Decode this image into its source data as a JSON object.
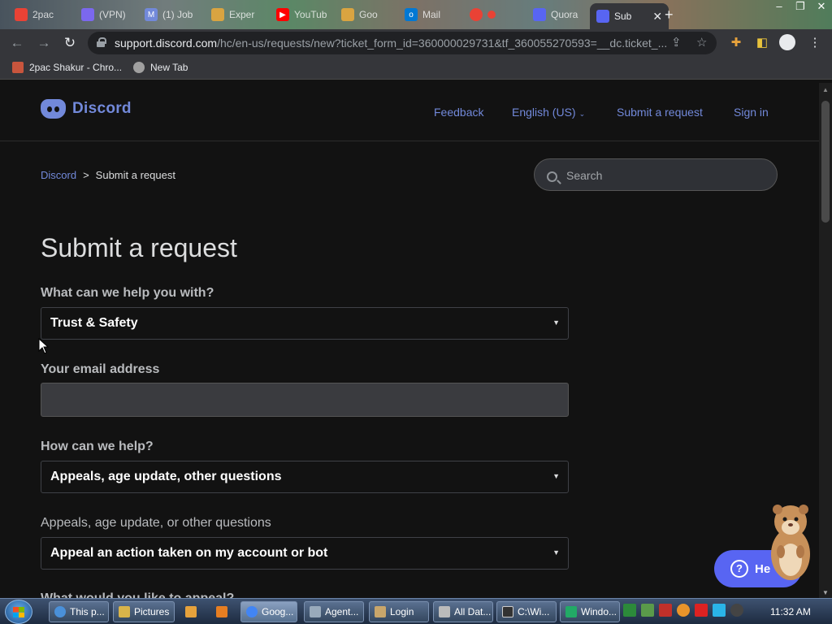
{
  "browser": {
    "tabs": [
      {
        "label": "2pac",
        "color": "#e94235"
      },
      {
        "label": "(VPN)",
        "color": "#7b68ee"
      },
      {
        "label": "(1) Job",
        "color": "#7289da"
      },
      {
        "label": "Exper",
        "color": "#d9a441"
      },
      {
        "label": "YouTub",
        "color": "#ff0000"
      },
      {
        "label": "Goo",
        "color": "#d9a441"
      },
      {
        "label": "Mail",
        "color": "#0078d4"
      },
      {
        "label": "",
        "color": "#e94235"
      },
      {
        "label": "Quora",
        "color": "#5865f2"
      },
      {
        "label": "Sub",
        "color": "#5865f2"
      }
    ],
    "url_host": "support.discord.com",
    "url_path": "/hc/en-us/requests/new?ticket_form_id=360000029731&tf_360055270593=__dc.ticket_...",
    "bookmarks": [
      {
        "label": "2pac Shakur - Chro...",
        "color": "#c8553d"
      },
      {
        "label": "New Tab",
        "color": "#a0a0a0"
      }
    ]
  },
  "site": {
    "brand": "Discord",
    "brand_color": "#7289da",
    "nav": {
      "feedback": "Feedback",
      "language": "English (US)",
      "submit": "Submit a request",
      "signin": "Sign in"
    },
    "breadcrumb": {
      "home": "Discord",
      "separator": ">",
      "current": "Submit a request"
    },
    "search": {
      "placeholder": "Search"
    }
  },
  "form": {
    "title": "Submit a request",
    "help_with_label": "What can we help you with?",
    "help_with_value": "Trust & Safety",
    "email_label": "Your email address",
    "email_value": "",
    "how_help_label": "How can we help?",
    "how_help_value": "Appeals, age update, other questions",
    "appeals_label": "Appeals, age update, or other questions",
    "appeals_value": "Appeal an action taken on my account or bot",
    "next_label": "What would you like to appeal?"
  },
  "help_widget": {
    "label": "He"
  },
  "taskbar": {
    "items": [
      {
        "label": "This p...",
        "color": "#4a90d9"
      },
      {
        "label": "Pictures",
        "color": "#d9b44a"
      },
      {
        "label": "",
        "color": "#e6a23c"
      },
      {
        "label": "",
        "color": "#e67e22"
      },
      {
        "label": "Goog...",
        "color": "#4285f4"
      },
      {
        "label": "Agent...",
        "color": "#9ab"
      },
      {
        "label": "Login",
        "color": "#c9a66b"
      },
      {
        "label": "All Dat...",
        "color": "#bbb"
      },
      {
        "label": "C:\\Wi...",
        "color": "#333"
      },
      {
        "label": "Windo...",
        "color": "#2a6"
      }
    ],
    "clock": "11:32 AM"
  }
}
